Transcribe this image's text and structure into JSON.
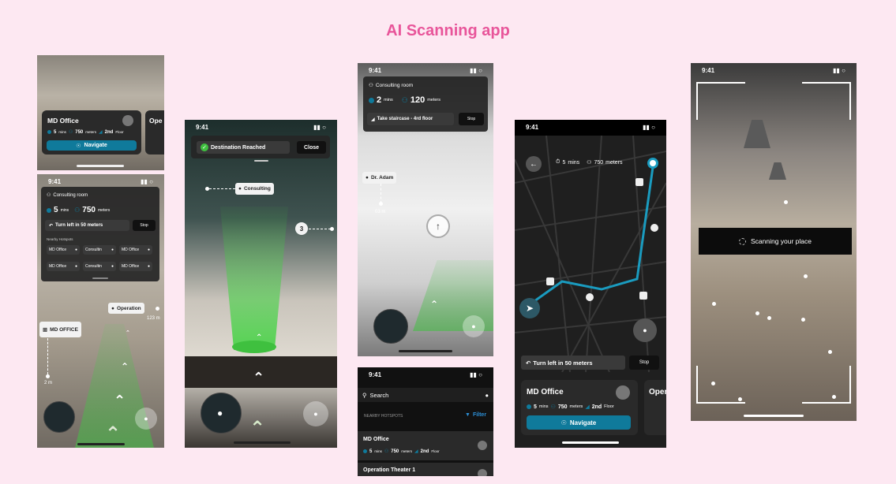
{
  "page_title": "AI Scanning app",
  "time": "9:41",
  "colors": {
    "accent": "#0f7a9b",
    "title": "#e8559a",
    "green": "#3fc03f"
  },
  "s1": {
    "card_title": "MD Office",
    "mins": "5",
    "mins_unit": "mins",
    "meters": "750",
    "meters_unit": "meters",
    "floor": "2nd",
    "floor_unit": "Floor",
    "navigate": "Navigate",
    "second_card_partial": "Ope"
  },
  "s2": {
    "dest_label": "Consulting room",
    "mins": "5",
    "mins_unit": "mins",
    "meters": "750",
    "meters_unit": "meters",
    "instruction": "Turn left in 50 meters",
    "stop": "Stop",
    "nearby_label": "Nearby Hotspots",
    "hotspots": [
      "MD Office",
      "Consultin",
      "MD Office",
      "MD Office",
      "Consultin",
      "MD Office"
    ],
    "operation_label": "Operation",
    "operation_distance": "123 m",
    "md_label": "MD OFFICE",
    "md_distance": "2 m"
  },
  "s3": {
    "dest_reached": "Destination Reached",
    "close": "Close",
    "consulting": "Consulting",
    "badge": "3"
  },
  "s4": {
    "dest_label": "Consulting room",
    "mins": "2",
    "mins_unit": "mins",
    "meters": "120",
    "meters_unit": "meters",
    "instruction": "Take staircase - 4rd floor",
    "stop": "Stop",
    "person_label": "Dr. Adam",
    "person_distance": "03 m"
  },
  "s5": {
    "search_placeholder": "Search",
    "nearby": "NEARBY HOTSPOTS",
    "filter": "Filter",
    "item1_title": "MD Office",
    "item1_mins": "5",
    "item1_mins_unit": "mins",
    "item1_meters": "750",
    "item1_meters_unit": "meters",
    "item1_floor": "2nd",
    "item1_floor_unit": "Floor",
    "item2_title": "Operation Theater 1"
  },
  "s6": {
    "mins": "5",
    "mins_unit": "mins",
    "meters": "750",
    "meters_unit": "meters",
    "instruction": "Turn left in 50 meters",
    "stop": "Stop",
    "card_title": "MD Office",
    "card_mins": "5",
    "card_mins_unit": "mins",
    "card_meters": "750",
    "card_meters_unit": "meters",
    "card_floor": "2nd",
    "card_floor_unit": "Floor",
    "navigate": "Navigate",
    "second_card_partial": "Oper"
  },
  "s7": {
    "scanning": "Scanning your place"
  }
}
